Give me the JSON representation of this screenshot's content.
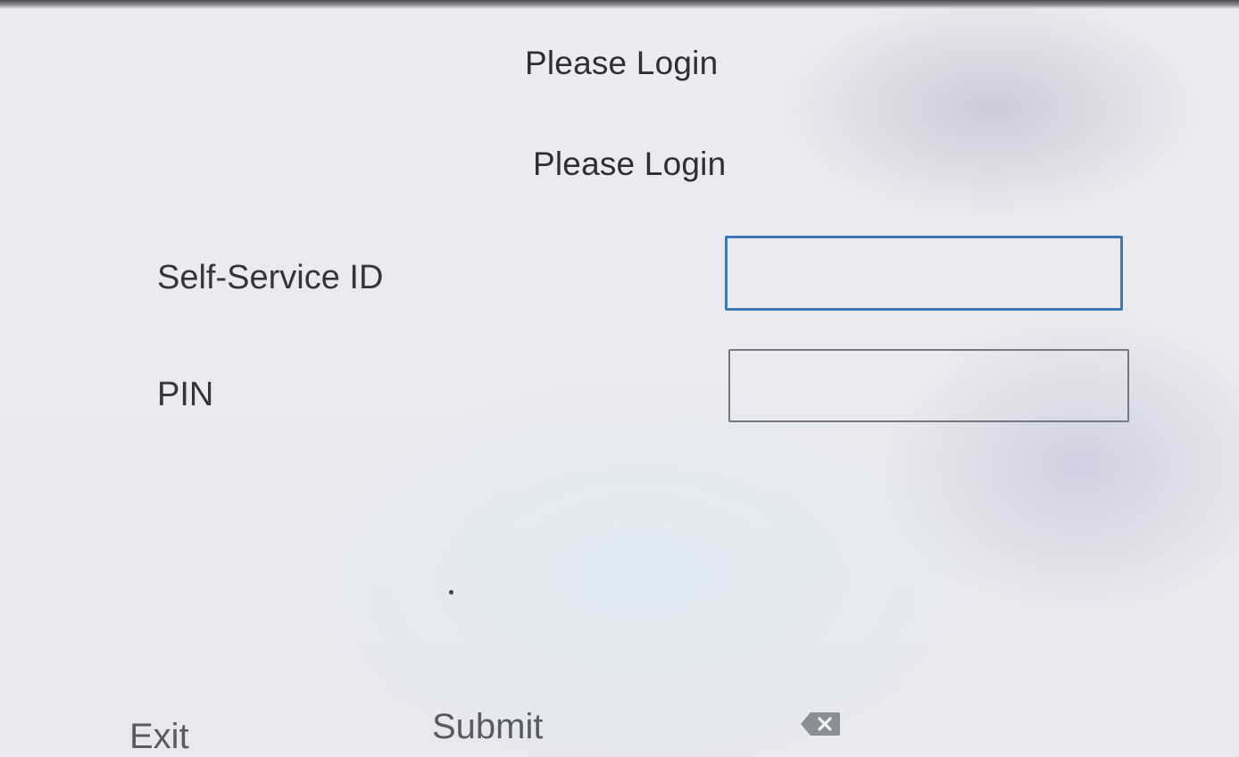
{
  "screen": {
    "title": "Please Login",
    "subtitle": "Please Login"
  },
  "form": {
    "self_service_id_label": "Self-Service ID",
    "self_service_id_value": "",
    "pin_label": "PIN",
    "pin_value": ""
  },
  "softkeys": {
    "exit_label": "Exit",
    "submit_label": "Submit",
    "backspace_icon": "backspace-icon"
  },
  "colors": {
    "active_field_border": "#3f78b6",
    "inactive_field_border": "#727985",
    "text": "#2f2f33"
  }
}
